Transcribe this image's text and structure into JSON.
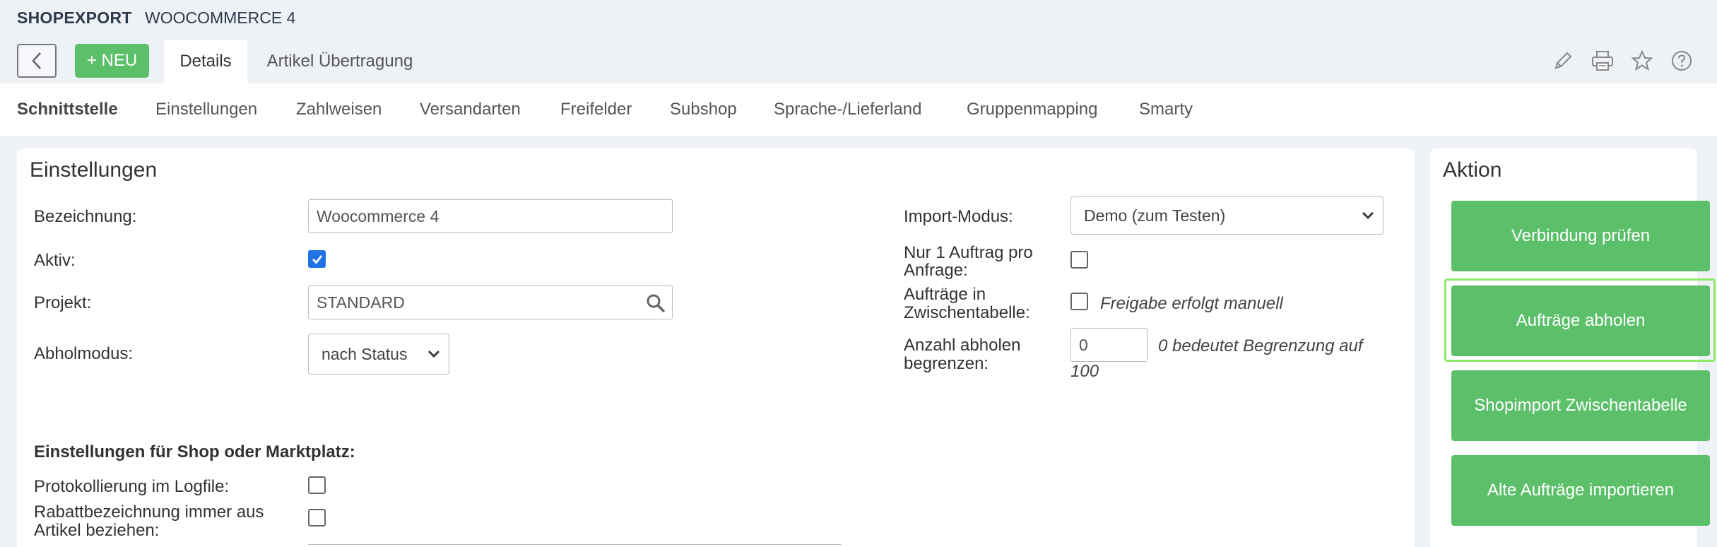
{
  "header": {
    "app_title": "SHOPEXPORT",
    "app_subtitle": "WOOCOMMERCE 4"
  },
  "toolbar": {
    "back_icon": "chevron-left-icon",
    "new_label": "+ NEU",
    "tabs": [
      {
        "label": "Details",
        "active": true
      },
      {
        "label": "Artikel Übertragung",
        "active": false
      }
    ],
    "icons": [
      "pencil-icon",
      "printer-icon",
      "star-icon",
      "help-icon"
    ]
  },
  "subnav": {
    "items": [
      {
        "label": "Schnittstelle",
        "active": true
      },
      {
        "label": "Einstellungen"
      },
      {
        "label": "Zahlweisen"
      },
      {
        "label": "Versandarten"
      },
      {
        "label": "Freifelder"
      },
      {
        "label": "Subshop"
      },
      {
        "label": "Sprache-/Lieferland"
      },
      {
        "label": "Gruppenmapping"
      },
      {
        "label": "Smarty"
      }
    ]
  },
  "settings": {
    "title": "Einstellungen",
    "bezeichnung": {
      "label": "Bezeichnung:",
      "value": "Woocommerce 4"
    },
    "aktiv": {
      "label": "Aktiv:",
      "checked": true
    },
    "projekt": {
      "label": "Projekt:",
      "value": "STANDARD"
    },
    "abholmodus": {
      "label": "Abholmodus:",
      "value": "nach Status"
    },
    "import_modus": {
      "label": "Import-Modus:",
      "value": "Demo (zum Testen)"
    },
    "nur_ein_auftrag": {
      "label_line1": "Nur 1 Auftrag pro",
      "label_line2": "Anfrage:",
      "checked": false
    },
    "zwischentabelle": {
      "label_line1": "Aufträge in",
      "label_line2": "Zwischentabelle:",
      "checked": false,
      "note": "Freigabe erfolgt manuell"
    },
    "anzahl": {
      "label_line1": "Anzahl abholen",
      "label_line2": "begrenzen:",
      "value": "0",
      "note_line1": "0 bedeutet Begrenzung auf",
      "note_line2": "100"
    },
    "shop_section": {
      "heading": "Einstellungen für Shop oder Marktplatz:",
      "protokoll": {
        "label": "Protokollierung im Logfile:",
        "checked": false
      },
      "rabatt": {
        "label_line1": "Rabattbezeichnung immer aus",
        "label_line2": "Artikel beziehen:",
        "checked": false
      }
    }
  },
  "action": {
    "title": "Aktion",
    "buttons": [
      "Verbindung prüfen",
      "Aufträge abholen",
      "Shopimport Zwischentabelle",
      "Alte Aufträge importieren"
    ],
    "focused_index": 1
  },
  "colors": {
    "accent_green": "#5cbf6a",
    "checkbox_blue": "#1f73e6",
    "focus_outline": "#8fe86a"
  }
}
